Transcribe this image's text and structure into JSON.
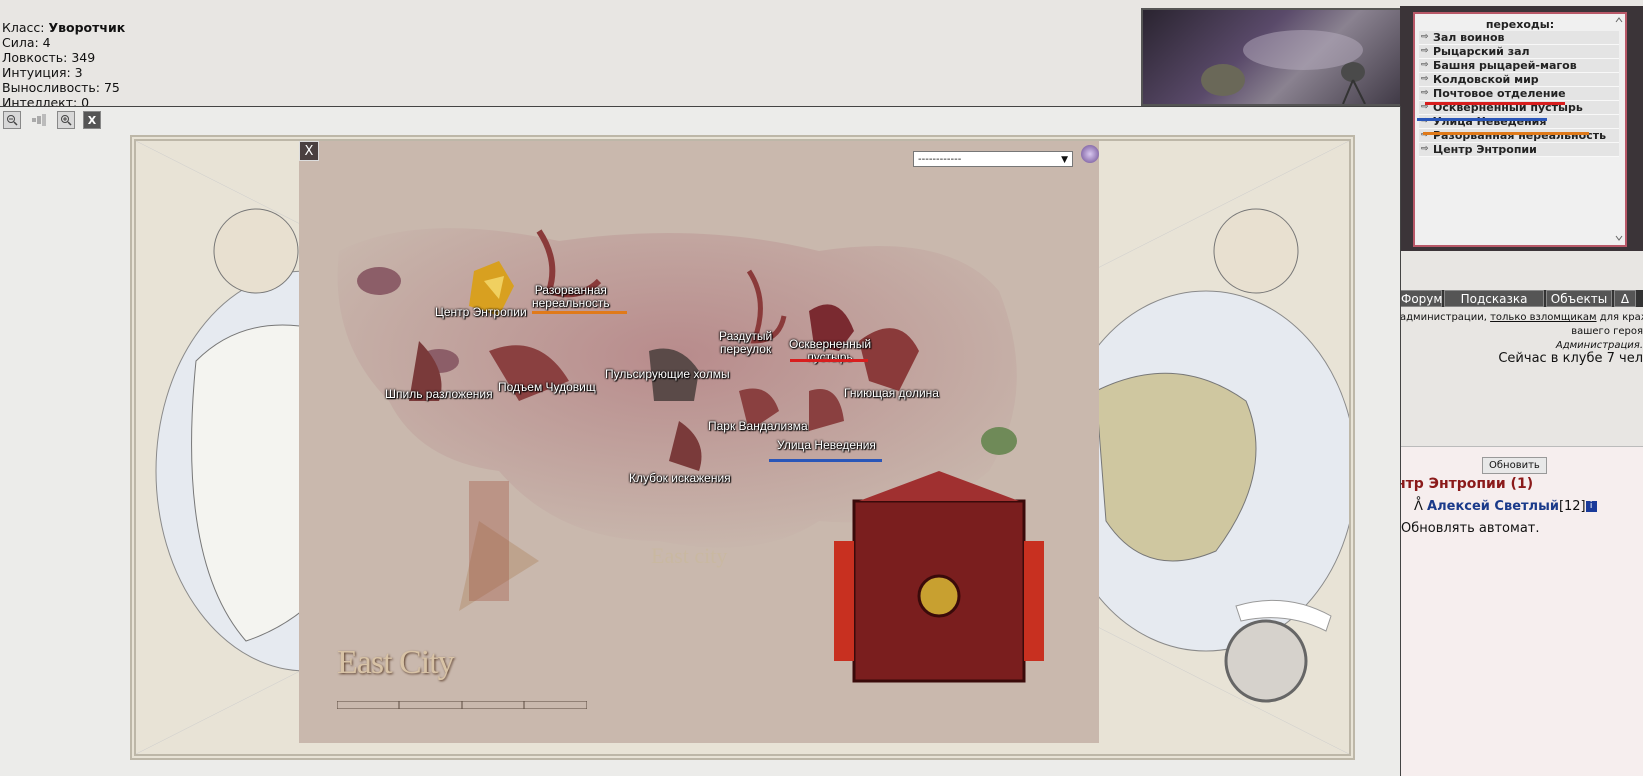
{
  "stats": {
    "class_label": "Класс:",
    "class_value": "Уворотчик",
    "strength": "Сила: 4",
    "agility": "Ловкость: 349",
    "intuition": "Интуиция: 3",
    "endurance": "Выносливость: 75",
    "intellect": "Интеллект: 0"
  },
  "toolbar": {
    "zoom_out_icon": "magnifier-minus-icon",
    "bars_icon": "signal-bars-icon",
    "zoom_in_icon": "magnifier-plus-icon",
    "close_label": "X"
  },
  "city_map": {
    "close_label": "X",
    "select_value": "------------",
    "select_arrow": "▼",
    "title": "East City",
    "center_text": "East city",
    "locations": {
      "center_entropy": "Центр Энтропии",
      "torn_unreality_1": "Разорванная",
      "torn_unreality_2": "нереальность",
      "bloated_alley_1": "Раздутый",
      "bloated_alley_2": "переулок",
      "defiled_waste_1": "Оскверненный",
      "defiled_waste_2": "пустырь",
      "pulsing_hills": "Пульсирующие холмы",
      "monster_rise": "Подъем Чудовищ",
      "decay_spire": "Шпиль разложения",
      "rotting_valley": "Гниющая долина",
      "vandalism_park": "Парк Вандализма",
      "ignorance_street": "Улица Неведения",
      "distortion_tangle": "Клубок искажения"
    },
    "underline_colors": {
      "orange": "#e07a1a",
      "red": "#d81e1e",
      "blue": "#2a56b8"
    }
  },
  "transitions": {
    "title": "переходы:",
    "arrow": "⇨",
    "items": [
      "Зал воинов",
      "Рыцарский зал",
      "Башня рыцарей-магов",
      "Колдовской мир",
      "Почтовое отделение",
      "Оскверненный пустырь",
      "Улица Неведения",
      "Разорванная нереальность",
      "Центр Энтропии"
    ]
  },
  "nav": {
    "forum": "Форум",
    "hint": "Подсказка",
    "objects": "Объекты",
    "delta": "Δ"
  },
  "admin": {
    "line1_a": "администрации, ",
    "line1_link": "только взломщикам",
    "line1_b": " для краж",
    "line2": "вашего героя",
    "line3": "Администрация."
  },
  "club_text": "Сейчас в клубе 7 чел",
  "room": {
    "refresh": "Обновить",
    "title": "нтр Энтропии (1)",
    "player_icon": "ᐰ",
    "player_name": "Алексей Светлый",
    "player_level": "[12]",
    "info_icon": "i",
    "auto_refresh": "Обновлять автомат."
  }
}
